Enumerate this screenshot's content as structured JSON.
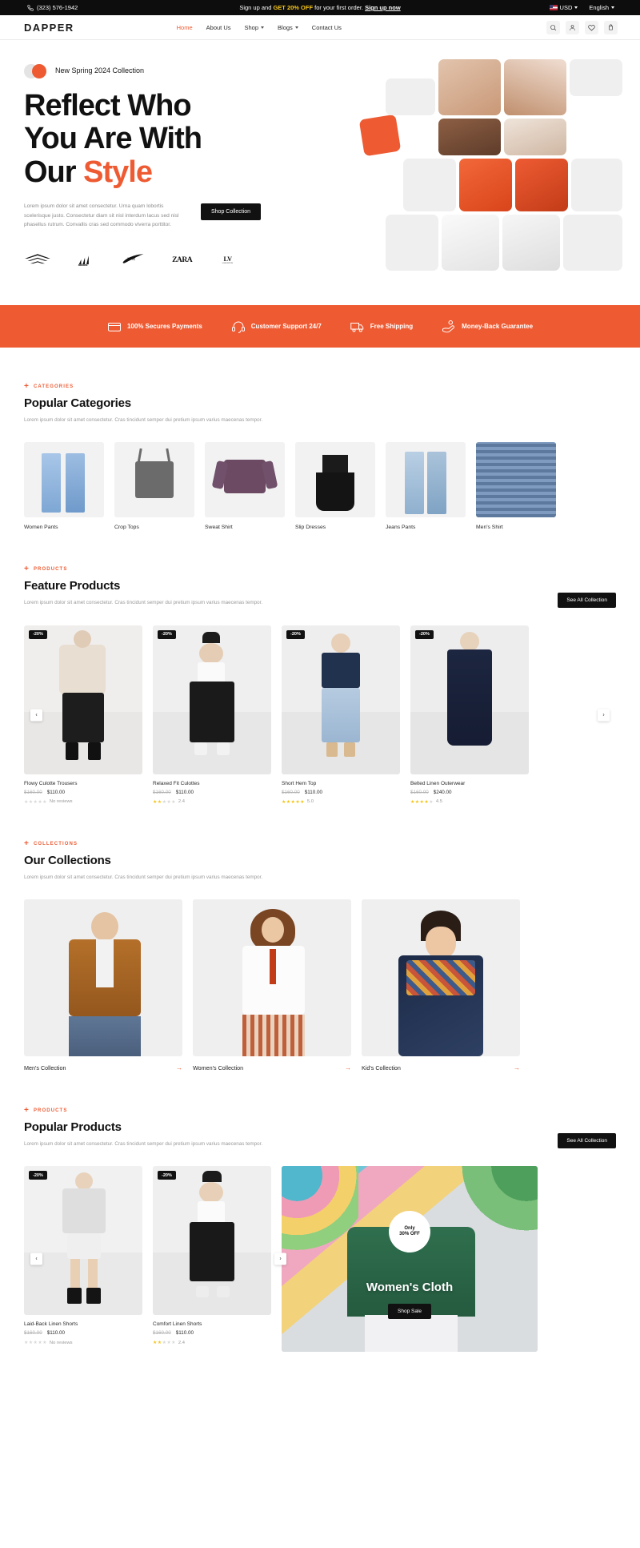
{
  "announcement": {
    "phone": "(323) 576-1942",
    "promo_prefix": "Sign up and ",
    "promo_highlight": "GET 20% OFF",
    "promo_suffix": " for your first order. ",
    "promo_link": "Sign up now",
    "currency": "USD",
    "language": "English"
  },
  "header": {
    "logo": "DAPPER",
    "nav": [
      {
        "label": "Home",
        "active": true,
        "caret": false
      },
      {
        "label": "About Us",
        "active": false,
        "caret": false
      },
      {
        "label": "Shop",
        "active": false,
        "caret": true
      },
      {
        "label": "Blogs",
        "active": false,
        "caret": true
      },
      {
        "label": "Contact Us",
        "active": false,
        "caret": false
      }
    ],
    "icons": [
      "search-icon",
      "account-icon",
      "wishlist-icon",
      "cart-icon"
    ]
  },
  "hero": {
    "pill": "New Spring 2024 Collection",
    "title_line1": "Reflect Who",
    "title_line2": "You Are With",
    "title_line3_plain": "Our ",
    "title_line3_accent": "Style",
    "paragraph": "Lorem ipsum dolor sit amet consectetur. Urna quam lobortis scelerisque justo. Consectetur diam sit nisl interdum lacus sed nisl phasellus rutrum. Convallis cras sed commodo viverra porttitor.",
    "cta": "Shop Collection",
    "brands": [
      "Armani",
      "adidas",
      "NIKE",
      "ZARA",
      "LOUIS VUITTON"
    ]
  },
  "feature_bar": [
    {
      "icon": "card-icon",
      "label": "100% Secures Payments"
    },
    {
      "icon": "headset-icon",
      "label": "Customer Support 24/7"
    },
    {
      "icon": "truck-icon",
      "label": "Free Shipping"
    },
    {
      "icon": "money-back-icon",
      "label": "Money-Back Guarantee"
    }
  ],
  "categories_section": {
    "eyebrow": "CATEGORIES",
    "title": "Popular Categories",
    "subtitle": "Lorem ipsum dolor sit amet consectetur. Cras tincidunt semper dui pretium ipsum varius maecenas tempor.",
    "items": [
      {
        "name": "Women Pants"
      },
      {
        "name": "Crop Tops"
      },
      {
        "name": "Sweat Shirt"
      },
      {
        "name": "Slip Dresses"
      },
      {
        "name": "Jeans Pants"
      },
      {
        "name": "Men's Shirt"
      }
    ]
  },
  "feature_products": {
    "eyebrow": "PRODUCTS",
    "title": "Feature Products",
    "subtitle": "Lorem ipsum dolor sit amet consectetur. Cras tincidunt semper dui pretium ipsum varius maecenas tempor.",
    "see_all": "See All Collection",
    "items": [
      {
        "badge": "-20%",
        "name": "Flowy Culotte Trousers",
        "old_price": "$160.00",
        "new_price": "$110.00",
        "stars": 0,
        "rating_label": "No reviews"
      },
      {
        "badge": "-20%",
        "name": "Relaxed Fit Culottes",
        "old_price": "$160.00",
        "new_price": "$110.00",
        "stars": 2,
        "rating_label": "2.4"
      },
      {
        "badge": "-20%",
        "name": "Short Hem Top",
        "old_price": "$160.00",
        "new_price": "$110.00",
        "stars": 5,
        "rating_label": "5.0"
      },
      {
        "badge": "-20%",
        "name": "Belted Linen Outerwear",
        "old_price": "$160.00",
        "new_price": "$240.00",
        "stars": 4,
        "rating_label": "4.5"
      }
    ]
  },
  "collections_section": {
    "eyebrow": "COLLECTIONS",
    "title": "Our Collections",
    "subtitle": "Lorem ipsum dolor sit amet consectetur. Cras tincidunt semper dui pretium ipsum varius maecenas tempor.",
    "items": [
      {
        "name": "Men's Collection",
        "arrow": "→"
      },
      {
        "name": "Women's Collection",
        "arrow": "→"
      },
      {
        "name": "Kid's Collection",
        "arrow": "→"
      }
    ]
  },
  "popular_products": {
    "eyebrow": "PRODUCTS",
    "title": "Popular Products",
    "subtitle": "Lorem ipsum dolor sit amet consectetur. Cras tincidunt semper dui pretium ipsum varius maecenas tempor.",
    "see_all": "See All Collection",
    "items": [
      {
        "badge": "-20%",
        "name": "Laid-Back Linen Shorts",
        "old_price": "$160.00",
        "new_price": "$110.00",
        "stars": 0,
        "rating_label": "No reviews"
      },
      {
        "badge": "-20%",
        "name": "Comfort Linen Shorts",
        "old_price": "$160.00",
        "new_price": "$110.00",
        "stars": 2,
        "rating_label": "2.4"
      }
    ],
    "promo": {
      "badge_line1": "Only",
      "badge_line2": "30% OFF",
      "title": "Women's Cloth",
      "cta": "Shop Sale"
    }
  },
  "colors": {
    "accent": "#ee5b33",
    "dark": "#111111",
    "star": "#f5c518"
  }
}
